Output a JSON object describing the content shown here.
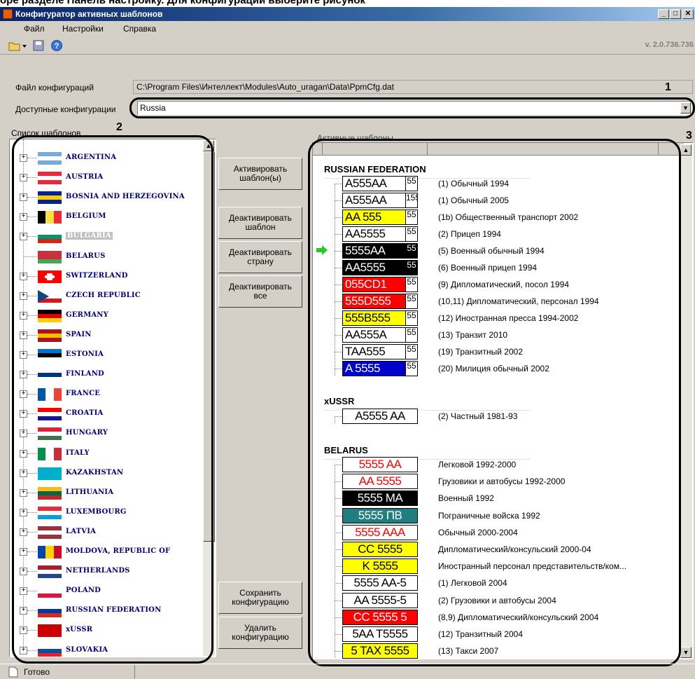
{
  "top_fragment": "оре разделе Панель настройку. Для конфигурации выберите рисунок",
  "window": {
    "title": "Конфигуратор активных шаблонов"
  },
  "menu": {
    "items": [
      "Файл",
      "Настройки",
      "Справка"
    ]
  },
  "toolbar": {
    "version": "v. 2.0.736.736",
    "icons": [
      "open-folder-icon",
      "dropdown-arrow-icon",
      "save-icon",
      "help-icon"
    ]
  },
  "config": {
    "file_label": "Файл конфигураций",
    "file_path": "C:\\Program Files\\Интеллект\\Modules\\Auto_uragan\\Data\\PpmCfg.dat",
    "available_label": "Доступные конфигурации",
    "selected": "Russia"
  },
  "annotations": {
    "n1": "1",
    "n2": "2",
    "n3": "3"
  },
  "templates_list": {
    "title": "Список шаблонов",
    "selected": "BULGARIA",
    "items": [
      {
        "name": "ARGENTINA",
        "flag": [
          "#74acdf",
          "#ffffff",
          "#74acdf"
        ]
      },
      {
        "name": "AUSTRIA",
        "flag": [
          "#ed2939",
          "#ffffff",
          "#ed2939"
        ]
      },
      {
        "name": "BOSNIA AND HERZEGOVINA",
        "flag": [
          "#002395",
          "#fecb00",
          "#002395"
        ]
      },
      {
        "name": "BELGIUM",
        "flag": [
          "#000000",
          "#fae042",
          "#ed2939"
        ],
        "vertical": true
      },
      {
        "name": "BULGARIA",
        "flag": [
          "#ffffff",
          "#00966e",
          "#d62612"
        ]
      },
      {
        "name": "BELARUS",
        "flag": [
          "#c8313e",
          "#c8313e",
          "#4aa657"
        ],
        "no_expander": true
      },
      {
        "name": "SWITZERLAND",
        "flag": [
          "#ff0000",
          "#ff0000",
          "#ff0000"
        ],
        "cross": true
      },
      {
        "name": "CZECH REPUBLIC",
        "flag": [
          "#ffffff",
          "#ffffff",
          "#d7141a"
        ],
        "triangle": "#11457e"
      },
      {
        "name": "GERMANY",
        "flag": [
          "#000000",
          "#dd0000",
          "#ffce00"
        ]
      },
      {
        "name": "SPAIN",
        "flag": [
          "#aa151b",
          "#f1bf00",
          "#aa151b"
        ]
      },
      {
        "name": "ESTONIA",
        "flag": [
          "#0072ce",
          "#000000",
          "#ffffff"
        ]
      },
      {
        "name": "FINLAND",
        "flag": [
          "#ffffff",
          "#003580",
          "#ffffff"
        ]
      },
      {
        "name": "FRANCE",
        "flag": [
          "#0055a4",
          "#ffffff",
          "#ef4135"
        ],
        "vertical": true
      },
      {
        "name": "CROATIA",
        "flag": [
          "#ff0000",
          "#ffffff",
          "#171796"
        ]
      },
      {
        "name": "HUNGARY",
        "flag": [
          "#ce2939",
          "#ffffff",
          "#477050"
        ]
      },
      {
        "name": "ITALY",
        "flag": [
          "#009246",
          "#ffffff",
          "#ce2b37"
        ],
        "vertical": true
      },
      {
        "name": "KAZAKHSTAN",
        "flag": [
          "#00afca",
          "#00afca",
          "#00afca"
        ]
      },
      {
        "name": "LITHUANIA",
        "flag": [
          "#fdb913",
          "#006a44",
          "#c1272d"
        ]
      },
      {
        "name": "LUXEMBOURG",
        "flag": [
          "#ed2939",
          "#ffffff",
          "#00a1de"
        ]
      },
      {
        "name": "LATVIA",
        "flag": [
          "#9e3039",
          "#ffffff",
          "#9e3039"
        ]
      },
      {
        "name": "MOLDOVA, REPUBLIC OF",
        "flag": [
          "#0046ae",
          "#ffd200",
          "#cc092f"
        ],
        "vertical": true
      },
      {
        "name": "NETHERLANDS",
        "flag": [
          "#ae1c28",
          "#ffffff",
          "#21468b"
        ]
      },
      {
        "name": "POLAND",
        "flag": [
          "#ffffff",
          "#ffffff",
          "#dc143c"
        ]
      },
      {
        "name": "RUSSIAN FEDERATION",
        "flag": [
          "#ffffff",
          "#0039a6",
          "#d52b1e"
        ]
      },
      {
        "name": "xUSSR",
        "flag": [
          "#cc0000",
          "#cc0000",
          "#cc0000"
        ]
      },
      {
        "name": "SLOVAKIA",
        "flag": [
          "#ffffff",
          "#0b4ea2",
          "#ee1c25"
        ]
      }
    ]
  },
  "buttons": {
    "activate": "Активировать\nшаблон(ы)",
    "deactivate_template": "Деактивировать\nшаблон",
    "deactivate_country": "Деактивировать\nстрану",
    "deactivate_all": "Деактивировать\nвсе",
    "save_config": "Сохранить\nконфигурацию",
    "delete_config": "Удалить\nконфигурацию"
  },
  "active_templates": {
    "title": "Активные шаблоны",
    "groups": [
      {
        "name": "RUSSIAN FEDERATION",
        "plates": [
          {
            "text": "A555AA",
            "bg": "#ffffff",
            "fg": "#000000",
            "reg": "55",
            "desc": "(1) Обычный 1994"
          },
          {
            "text": "A555AA",
            "bg": "#ffffff",
            "fg": "#000000",
            "reg": "155",
            "desc": "(1) Обычный 2005"
          },
          {
            "text": "AA 555",
            "bg": "#ffff00",
            "fg": "#000000",
            "reg": "55",
            "desc": "(1b) Общественный транспорт 2002"
          },
          {
            "text": "AA5555",
            "bg": "#ffffff",
            "fg": "#000000",
            "reg": "55",
            "desc": "(2) Прицеп 1994"
          },
          {
            "text": "5555AA",
            "bg": "#000000",
            "fg": "#ffffff",
            "reg": "55",
            "desc": "(5) Военный обычный 1994",
            "arrow": true
          },
          {
            "text": "AA5555",
            "bg": "#000000",
            "fg": "#ffffff",
            "reg": "55",
            "desc": "(6) Военный прицеп 1994"
          },
          {
            "text": "055CD1",
            "bg": "#ff0000",
            "fg": "#ffffff",
            "reg": "55",
            "desc": "(9) Дипломатический, посол 1994"
          },
          {
            "text": "555D555",
            "bg": "#ff0000",
            "fg": "#ffffff",
            "reg": "55",
            "desc": "(10,11) Дипломатический, персонал 1994"
          },
          {
            "text": "555B555",
            "bg": "#ffff00",
            "fg": "#000000",
            "reg": "55",
            "desc": "(12) Иностранная пресса 1994-2002"
          },
          {
            "text": "AA555A",
            "bg": "#ffffff",
            "fg": "#000000",
            "reg": "55",
            "desc": "(13) Транзит 2010"
          },
          {
            "text": "TAA555",
            "bg": "#ffffff",
            "fg": "#000000",
            "reg": "55",
            "desc": "(19) Транзитный 2002"
          },
          {
            "text": "A 5555",
            "bg": "#0000cc",
            "fg": "#ffffff",
            "reg": "55",
            "desc": "(20) Милиция обычный 2002"
          }
        ]
      },
      {
        "name": "xUSSR",
        "plates": [
          {
            "text": "A5555 AA",
            "bg": "#ffffff",
            "fg": "#000000",
            "reg": "",
            "desc": "(2) Частный 1981-93"
          }
        ]
      },
      {
        "name": "BELARUS",
        "plates": [
          {
            "text": "5555 AA",
            "bg": "#ffffff",
            "fg": "#ff0000",
            "reg": "",
            "desc": "Легковой 1992-2000"
          },
          {
            "text": "AA 5555",
            "bg": "#ffffff",
            "fg": "#ff0000",
            "reg": "",
            "desc": "Грузовики и автобусы 1992-2000"
          },
          {
            "text": "5555 MA",
            "bg": "#000000",
            "fg": "#ffffff",
            "reg": "",
            "desc": "Военный 1992"
          },
          {
            "text": "5555 ПВ",
            "bg": "#1f7f7f",
            "fg": "#ffffff",
            "reg": "",
            "desc": "Пограничные войска 1992"
          },
          {
            "text": "5555 AAA",
            "bg": "#ffffff",
            "fg": "#ff0000",
            "reg": "",
            "desc": "Обычный 2000-2004"
          },
          {
            "text": "CC 5555",
            "bg": "#ffff00",
            "fg": "#000000",
            "reg": "",
            "desc": "Дипломатический/консульский 2000-04"
          },
          {
            "text": "K 5555",
            "bg": "#ffff00",
            "fg": "#000000",
            "reg": "",
            "desc": "Иностранный персонал представительств/ком..."
          },
          {
            "text": "5555 AA-5",
            "bg": "#ffffff",
            "fg": "#000000",
            "reg": "",
            "desc": "(1) Легковой 2004"
          },
          {
            "text": "AA 5555-5",
            "bg": "#ffffff",
            "fg": "#000000",
            "reg": "",
            "desc": "(2) Грузовики и автобусы 2004"
          },
          {
            "text": "CC 5555 5",
            "bg": "#ff0000",
            "fg": "#ffffff",
            "reg": "",
            "desc": "(8,9) Дипломатический/консульский 2004"
          },
          {
            "text": "5AA T5555",
            "bg": "#ffffff",
            "fg": "#000000",
            "reg": "",
            "desc": "(12) Транзитный 2004"
          },
          {
            "text": "5 TAX 5555",
            "bg": "#ffff00",
            "fg": "#000000",
            "reg": "",
            "desc": "(13) Такси 2007"
          }
        ]
      }
    ]
  },
  "status": {
    "text": "Готово"
  }
}
